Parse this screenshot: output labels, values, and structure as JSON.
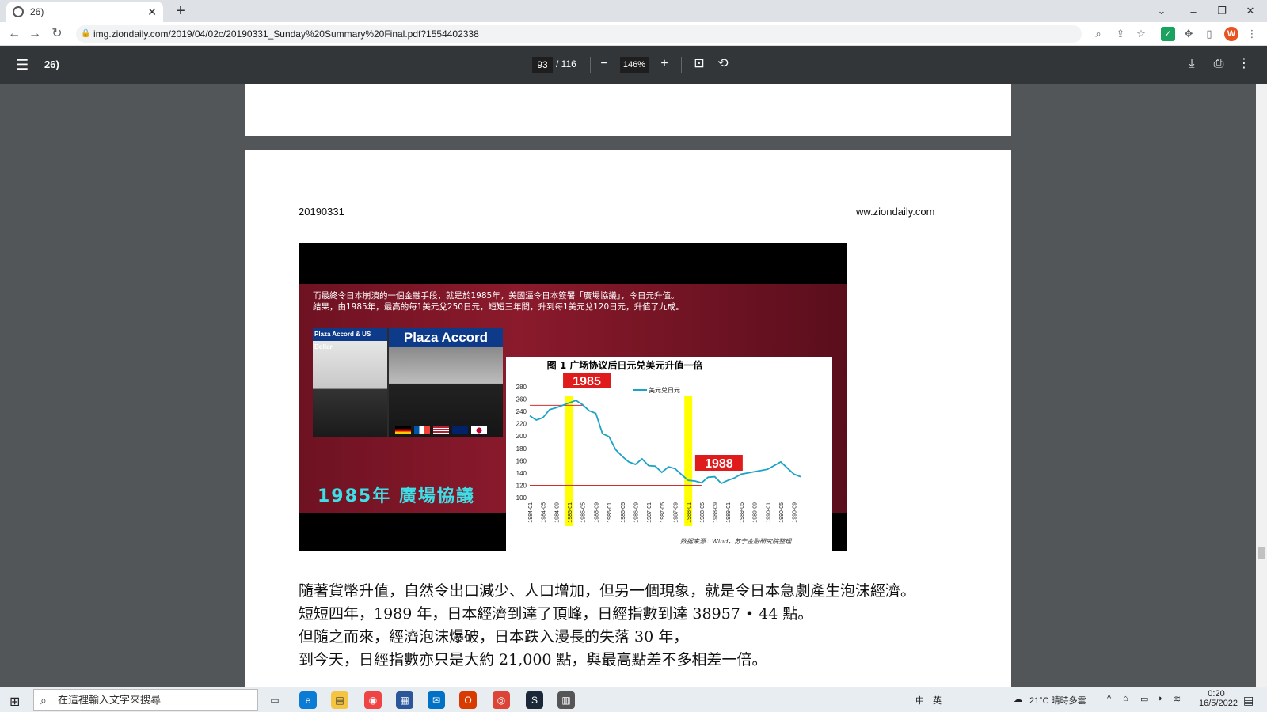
{
  "browser": {
    "tab_title": "26)",
    "url": "img.ziondaily.com/2019/04/02c/20190331_Sunday%20Summary%20Final.pdf?1554402338",
    "new_tab": "+",
    "win_min": "–",
    "win_restore": "❐",
    "win_close": "✕",
    "win_tabsearch": "⌄"
  },
  "pdf_toolbar": {
    "title": "26)",
    "current_page": "93",
    "total_pages": "/ 116",
    "zoom": "146%"
  },
  "page": {
    "header_left": "20190331",
    "header_right": "ww.ziondaily.com",
    "image_caption_line1": "而最終令日本崩潰的一個金融手段，就是於1985年，美國逼令日本簽署「廣場協議」，令日元升值。",
    "image_caption_line2": "結果，由1985年，最高的每1美元兌250日元，短短三年間，升到每1美元兌120日元，升值了九成。",
    "plaza_small_title": "Plaza Accord & US Dollar",
    "plaza_big_title": "Plaza Accord",
    "big_caption": "1985年 廣場協議",
    "chart_source": "数据来源：Wind，苏宁金融研究院整理",
    "paragraphs": [
      "隨著貨幣升值，自然令出口減少、人口增加，但另一個現象，就是令日本急劇產生泡沫經濟。",
      "短短四年，1989 年，日本經濟到達了頂峰，日經指數到達 38957 • 44 點。",
      "但隨之而來，經濟泡沫爆破，日本跌入漫長的失落 30 年，",
      "到今天，日經指數亦只是大約 21,000 點，與最高點差不多相差一倍。"
    ]
  },
  "chart_data": {
    "type": "line",
    "title": "图 1 广场协议后日元兑美元升值一倍",
    "legend": "美元兑日元",
    "ylim": [
      100,
      280
    ],
    "yticks": [
      100,
      120,
      140,
      160,
      180,
      200,
      220,
      240,
      260,
      280
    ],
    "xticks": [
      "1984-01",
      "1984-05",
      "1984-09",
      "1985-01",
      "1985-05",
      "1985-09",
      "1986-01",
      "1986-05",
      "1986-09",
      "1987-01",
      "1987-05",
      "1987-09",
      "1988-01",
      "1988-05",
      "1988-09",
      "1989-01",
      "1989-05",
      "1989-09",
      "1990-01",
      "1990-05",
      "1990-09"
    ],
    "x": [
      "1984-01",
      "1984-03",
      "1984-05",
      "1984-07",
      "1984-09",
      "1984-11",
      "1985-01",
      "1985-03",
      "1985-05",
      "1985-07",
      "1985-09",
      "1985-11",
      "1986-01",
      "1986-03",
      "1986-05",
      "1986-07",
      "1986-09",
      "1986-11",
      "1987-01",
      "1987-03",
      "1987-05",
      "1987-07",
      "1987-09",
      "1987-11",
      "1988-01",
      "1988-03",
      "1988-05",
      "1988-07",
      "1988-09",
      "1988-11",
      "1989-01",
      "1989-03",
      "1989-05",
      "1989-07",
      "1989-09",
      "1989-11",
      "1990-01",
      "1990-03",
      "1990-05",
      "1990-07",
      "1990-09",
      "1990-11"
    ],
    "values": [
      233,
      226,
      230,
      243,
      246,
      250,
      254,
      258,
      251,
      241,
      237,
      204,
      199,
      178,
      167,
      158,
      154,
      163,
      152,
      151,
      141,
      150,
      147,
      137,
      128,
      127,
      124,
      133,
      134,
      123,
      128,
      132,
      138,
      140,
      142,
      144,
      146,
      152,
      158,
      148,
      138,
      134
    ],
    "annotations": [
      "1985",
      "1988"
    ],
    "highlight_x": [
      "1985-01",
      "1988-01"
    ],
    "reference_line": 120,
    "reference_line_2": 250,
    "colors": {
      "line": "#1ba3c6",
      "highlight": "#ffff00",
      "ref": "#d32f2f",
      "callout": "#e01b1b"
    }
  },
  "taskbar": {
    "search_placeholder": "在這裡輸入文字來搜尋",
    "weather": "21°C 晴時多雲",
    "time": "0:20",
    "date": "16/5/2022",
    "ime": "中",
    "ime2": "英"
  }
}
